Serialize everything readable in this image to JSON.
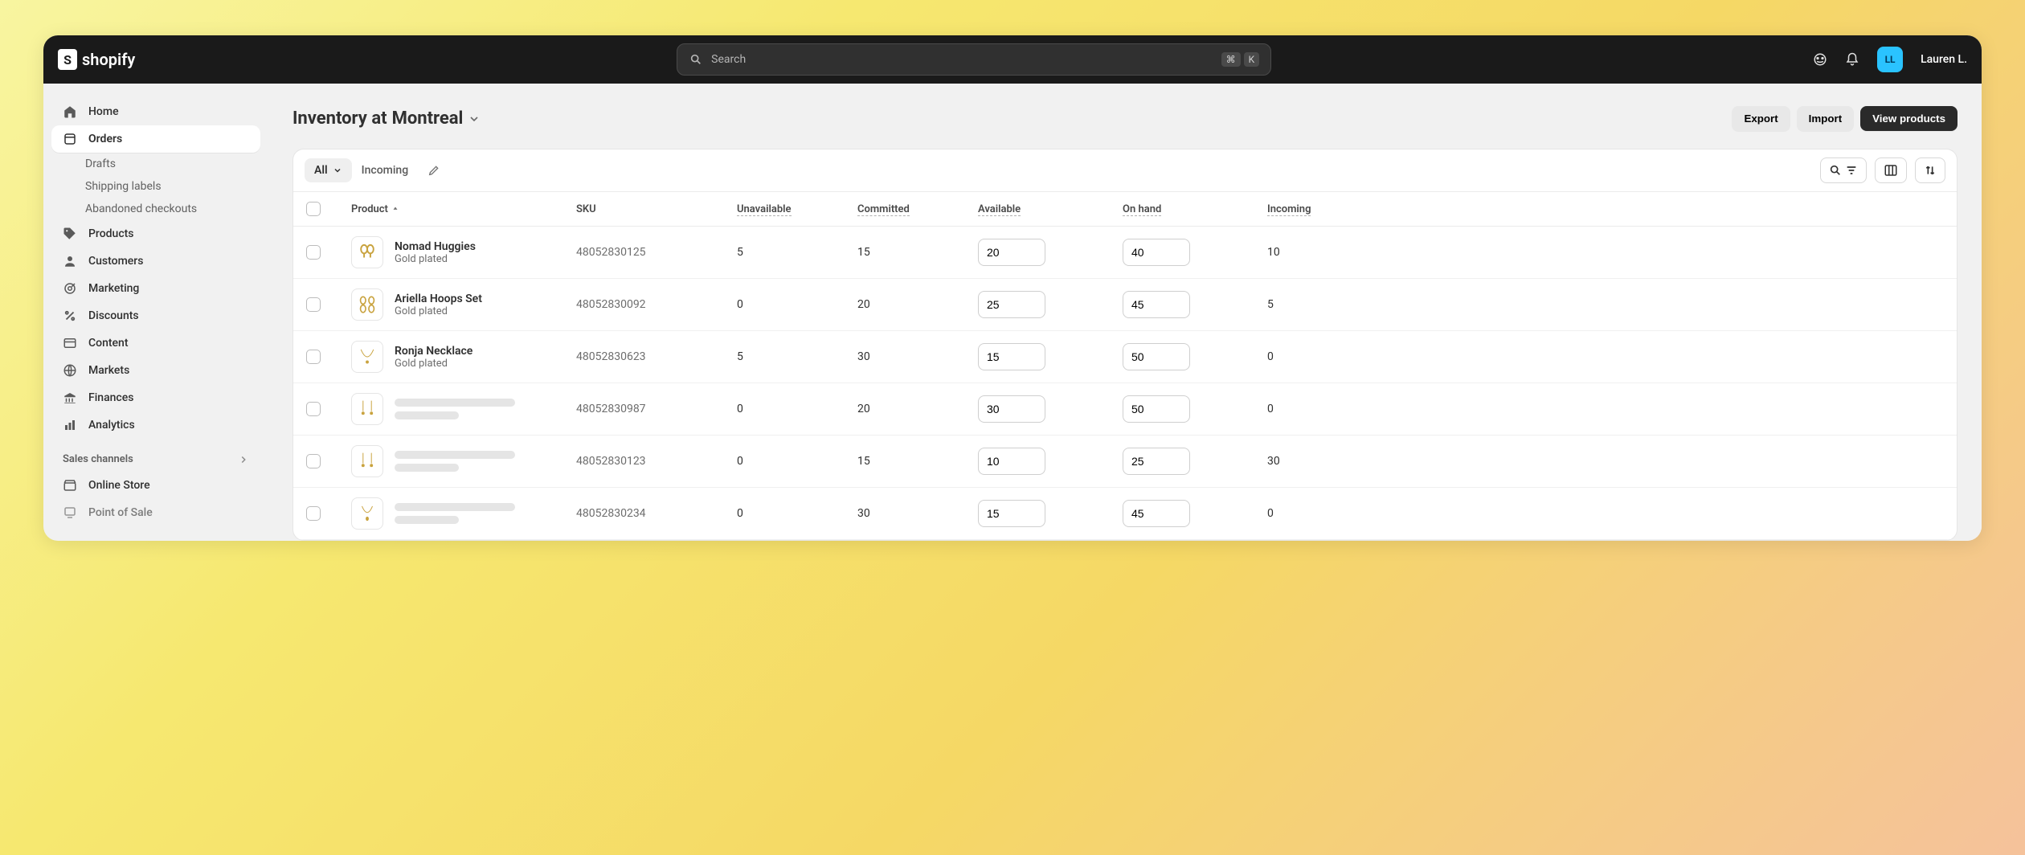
{
  "topbar": {
    "brand": "shopify",
    "search_placeholder": "Search",
    "kbd1": "⌘",
    "kbd2": "K",
    "user_initials": "LL",
    "user_name": "Lauren L."
  },
  "sidebar": {
    "items": [
      {
        "label": "Home"
      },
      {
        "label": "Orders"
      },
      {
        "label": "Drafts"
      },
      {
        "label": "Shipping labels"
      },
      {
        "label": "Abandoned checkouts"
      },
      {
        "label": "Products"
      },
      {
        "label": "Customers"
      },
      {
        "label": "Marketing"
      },
      {
        "label": "Discounts"
      },
      {
        "label": "Content"
      },
      {
        "label": "Markets"
      },
      {
        "label": "Finances"
      },
      {
        "label": "Analytics"
      }
    ],
    "section_label": "Sales channels",
    "channels": [
      {
        "label": "Online Store"
      },
      {
        "label": "Point of Sale"
      }
    ]
  },
  "page": {
    "title_prefix": "Inventory at",
    "location": "Montreal",
    "actions": {
      "export": "Export",
      "import": "Import",
      "view": "View products"
    }
  },
  "tabs": {
    "all": "All",
    "incoming": "Incoming"
  },
  "columns": {
    "product": "Product",
    "sku": "SKU",
    "unavailable": "Unavailable",
    "committed": "Committed",
    "available": "Available",
    "onhand": "On hand",
    "incoming": "Incoming"
  },
  "rows": [
    {
      "name": "Nomad Huggies",
      "variant": "Gold plated",
      "sku": "48052830125",
      "unavailable": "5",
      "committed": "15",
      "available": "20",
      "onhand": "40",
      "incoming": "10",
      "placeholder": false
    },
    {
      "name": "Ariella Hoops Set",
      "variant": "Gold plated",
      "sku": "48052830092",
      "unavailable": "0",
      "committed": "20",
      "available": "25",
      "onhand": "45",
      "incoming": "5",
      "placeholder": false
    },
    {
      "name": "Ronja Necklace",
      "variant": "Gold plated",
      "sku": "48052830623",
      "unavailable": "5",
      "committed": "30",
      "available": "15",
      "onhand": "50",
      "incoming": "0",
      "placeholder": false
    },
    {
      "name": "",
      "variant": "",
      "sku": "48052830987",
      "unavailable": "0",
      "committed": "20",
      "available": "30",
      "onhand": "50",
      "incoming": "0",
      "placeholder": true
    },
    {
      "name": "",
      "variant": "",
      "sku": "48052830123",
      "unavailable": "0",
      "committed": "15",
      "available": "10",
      "onhand": "25",
      "incoming": "30",
      "placeholder": true
    },
    {
      "name": "",
      "variant": "",
      "sku": "48052830234",
      "unavailable": "0",
      "committed": "30",
      "available": "15",
      "onhand": "45",
      "incoming": "0",
      "placeholder": true
    }
  ]
}
